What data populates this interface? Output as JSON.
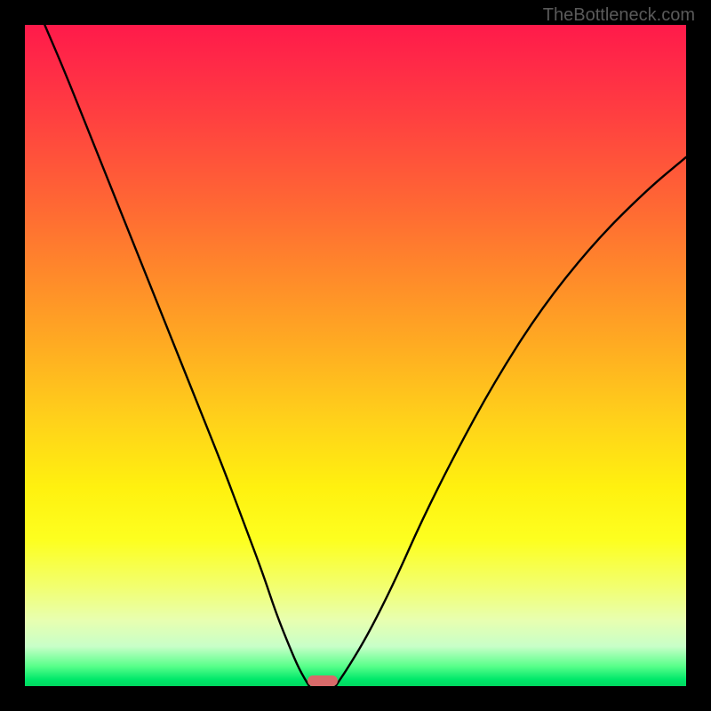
{
  "watermark": "TheBottleneck.com",
  "chart_data": {
    "type": "line",
    "title": "",
    "xlabel": "",
    "ylabel": "",
    "xlim": [
      0,
      100
    ],
    "ylim": [
      0,
      100
    ],
    "grid": false,
    "legend": false,
    "series": [
      {
        "name": "left-curve",
        "x": [
          3,
          6,
          10,
          14,
          18,
          22,
          26,
          30,
          33,
          36,
          38,
          40,
          41.5,
          43
        ],
        "y": [
          100,
          93,
          83,
          73,
          63,
          53,
          43,
          33,
          25,
          17,
          11,
          6,
          2.5,
          0
        ]
      },
      {
        "name": "right-curve",
        "x": [
          47,
          49,
          52,
          56,
          60,
          65,
          71,
          78,
          86,
          94,
          100
        ],
        "y": [
          0,
          3,
          8,
          16,
          25,
          35,
          46,
          57,
          67,
          75,
          80
        ]
      }
    ],
    "marker": {
      "name": "optimal-zone",
      "x_center": 45,
      "y": 0,
      "width_pct": 4.5,
      "height_pct": 1.6,
      "color": "#d96a6a"
    },
    "background_gradient": {
      "top": "#ff1a4a",
      "mid": "#fff10f",
      "bottom": "#00d860"
    }
  }
}
